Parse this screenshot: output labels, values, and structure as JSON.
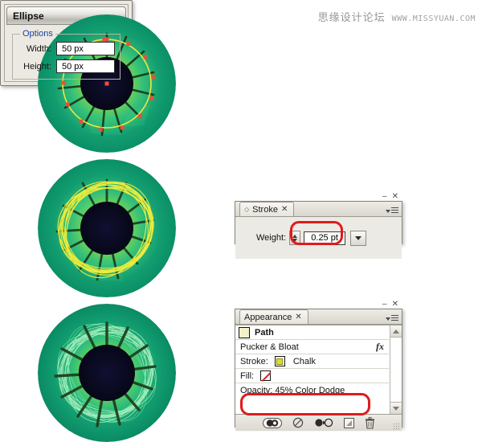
{
  "watermark": {
    "cn_text": "思缘设计论坛",
    "url_text": "WWW.MISSYUAN.COM"
  },
  "eyes": [
    {
      "name": "eye-step-1",
      "caption": "",
      "stage": "ellipse-path-with-anchor-points"
    },
    {
      "name": "eye-step-2",
      "caption": "",
      "stage": "chalk-stroke-025pt"
    },
    {
      "name": "eye-step-3",
      "caption": "",
      "stage": "opacity-45-color-dodge"
    }
  ],
  "ellipse_dialog": {
    "title": "Ellipse",
    "options_legend": "Options",
    "width_label": "Width:",
    "width_value": "50 px",
    "height_label": "Height:",
    "height_value": "50 px"
  },
  "stroke_panel": {
    "tab_label": "Stroke",
    "close_glyph": "✕",
    "minimize_glyph": "–",
    "window_close_glyph": "✕",
    "weight_label": "Weight:",
    "weight_value": "0.25 pt",
    "highlight_color": "#e01b1b"
  },
  "appearance_panel": {
    "tab_label": "Appearance",
    "close_glyph": "✕",
    "minimize_glyph": "–",
    "window_close_glyph": "✕",
    "rows": [
      {
        "label": "Path",
        "type": "header"
      },
      {
        "label": "Pucker & Bloat",
        "type": "effect",
        "badge": "fx"
      },
      {
        "label": "Stroke:",
        "type": "stroke",
        "value": "Chalk"
      },
      {
        "label": "Fill:",
        "type": "fill",
        "value": ""
      },
      {
        "label": "Opacity: 45% Color Dodge",
        "type": "opacity"
      }
    ],
    "footer_icons": [
      "new-art-basic-appearance-icon",
      "clear-appearance-icon",
      "reduce-to-basic-appearance-icon",
      "duplicate-item-icon",
      "delete-item-icon"
    ],
    "highlight_color": "#e01b1b"
  },
  "colors": {
    "iris_light": "#8ede4e",
    "iris_mid": "#49c45f",
    "sclera_outer": "#0f9e6f",
    "pupil": "#0b0b26",
    "path_stroke": "#f2e73a",
    "anchor_point": "#e8503a"
  }
}
